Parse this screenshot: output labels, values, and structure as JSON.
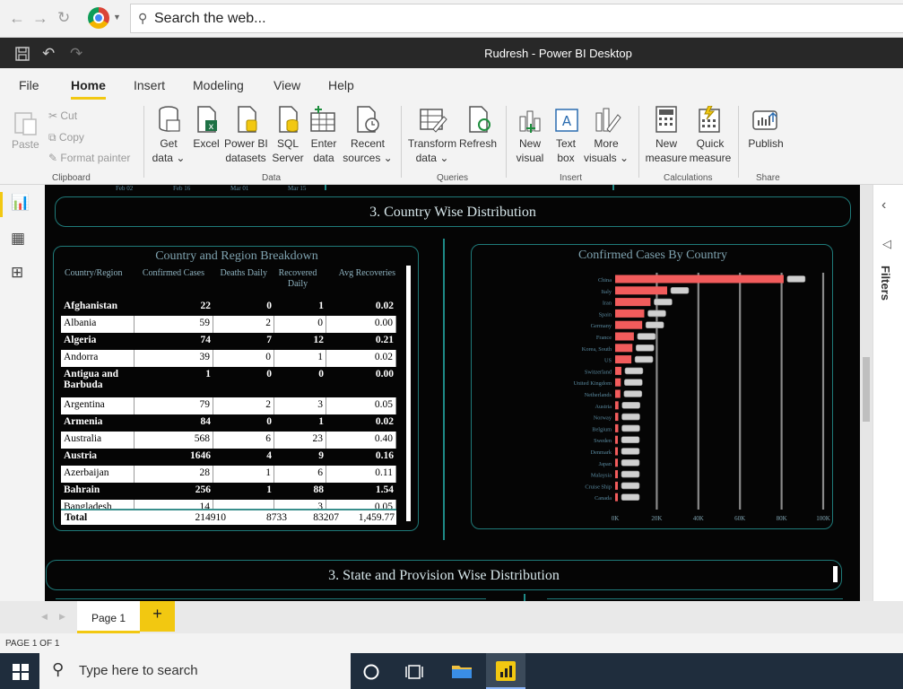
{
  "browser": {
    "search_placeholder": "Search the web..."
  },
  "window": {
    "title": "Rudresh - Power BI Desktop"
  },
  "menu": {
    "tabs": [
      "File",
      "Home",
      "Insert",
      "Modeling",
      "View",
      "Help"
    ],
    "active": "Home"
  },
  "ribbon": {
    "clipboard": {
      "paste": "Paste",
      "cut": "Cut",
      "copy": "Copy",
      "format_painter": "Format painter",
      "group": "Clipboard"
    },
    "data": {
      "get_data": [
        "Get",
        "data ⌄"
      ],
      "excel": "Excel",
      "powerbi_datasets": [
        "Power BI",
        "datasets"
      ],
      "sql_server": [
        "SQL",
        "Server"
      ],
      "enter_data": [
        "Enter",
        "data"
      ],
      "recent_sources": [
        "Recent",
        "sources ⌄"
      ],
      "group": "Data"
    },
    "queries": {
      "transform_data": [
        "Transform",
        "data ⌄"
      ],
      "refresh": "Refresh",
      "group": "Queries"
    },
    "insert": {
      "new_visual": [
        "New",
        "visual"
      ],
      "text_box": [
        "Text",
        "box"
      ],
      "more_visuals": [
        "More",
        "visuals ⌄"
      ],
      "group": "Insert"
    },
    "calculations": {
      "new_measure": [
        "New",
        "measure"
      ],
      "quick_measure": [
        "Quick",
        "measure"
      ],
      "group": "Calculations"
    },
    "share": {
      "publish": "Publish",
      "group": "Share"
    }
  },
  "canvas": {
    "date_ticks": [
      "Feb 02",
      "Feb 16",
      "Mar 01",
      "Mar 15"
    ],
    "section1_title": "3. Country Wise Distribution",
    "section2_title": "3. State and Provision Wise Distribution",
    "table": {
      "title": "Country and Region Breakdown",
      "headers": [
        "Country/Region",
        "Confirmed Cases",
        "Deaths Daily",
        "Recovered Daily",
        "Avg Recoveries"
      ],
      "rows": [
        {
          "country": "Afghanistan",
          "confirmed": "22",
          "deaths": "0",
          "recovered": "1",
          "avg": "0.02"
        },
        {
          "country": "Albania",
          "confirmed": "59",
          "deaths": "2",
          "recovered": "0",
          "avg": "0.00"
        },
        {
          "country": "Algeria",
          "confirmed": "74",
          "deaths": "7",
          "recovered": "12",
          "avg": "0.21"
        },
        {
          "country": "Andorra",
          "confirmed": "39",
          "deaths": "0",
          "recovered": "1",
          "avg": "0.02"
        },
        {
          "country": "Antigua and Barbuda",
          "confirmed": "1",
          "deaths": "0",
          "recovered": "0",
          "avg": "0.00"
        },
        {
          "country": "Argentina",
          "confirmed": "79",
          "deaths": "2",
          "recovered": "3",
          "avg": "0.05"
        },
        {
          "country": "Armenia",
          "confirmed": "84",
          "deaths": "0",
          "recovered": "1",
          "avg": "0.02"
        },
        {
          "country": "Australia",
          "confirmed": "568",
          "deaths": "6",
          "recovered": "23",
          "avg": "0.40"
        },
        {
          "country": "Austria",
          "confirmed": "1646",
          "deaths": "4",
          "recovered": "9",
          "avg": "0.16"
        },
        {
          "country": "Azerbaijan",
          "confirmed": "28",
          "deaths": "1",
          "recovered": "6",
          "avg": "0.11"
        },
        {
          "country": "Bahrain",
          "confirmed": "256",
          "deaths": "1",
          "recovered": "88",
          "avg": "1.54"
        },
        {
          "country": "Bangladesh",
          "confirmed": "14",
          "deaths": "",
          "recovered": "3",
          "avg": "0.05"
        }
      ],
      "total": {
        "label": "Total",
        "confirmed": "214910",
        "deaths": "8733",
        "recovered": "83207",
        "avg": "1,459.77"
      }
    }
  },
  "chart_data": {
    "type": "bar",
    "title": "Confirmed Cases By Country",
    "orientation": "horizontal",
    "categories": [
      "China",
      "Italy",
      "Iran",
      "Spain",
      "Germany",
      "France",
      "Korea, South",
      "US",
      "Switzerland",
      "United Kingdom",
      "Netherlands",
      "Austria",
      "Norway",
      "Belgium",
      "Sweden",
      "Denmark",
      "Japan",
      "Malaysia",
      "Cruise Ship",
      "Canada"
    ],
    "values": [
      81000,
      25000,
      17000,
      14000,
      13000,
      9000,
      8300,
      7800,
      3000,
      2700,
      2500,
      1600,
      1500,
      1500,
      1200,
      1000,
      900,
      800,
      700,
      600
    ],
    "x_ticks": [
      "0K",
      "20K",
      "40K",
      "60K",
      "80K",
      "100K"
    ],
    "xlim": [
      0,
      100000
    ],
    "bar_color": "#f25c5c",
    "grid": true
  },
  "pages": {
    "tab": "Page 1",
    "add": "+"
  },
  "status": "PAGE 1 OF 1",
  "taskbar": {
    "search_placeholder": "Type here to search"
  },
  "filters": {
    "label": "Filters"
  }
}
